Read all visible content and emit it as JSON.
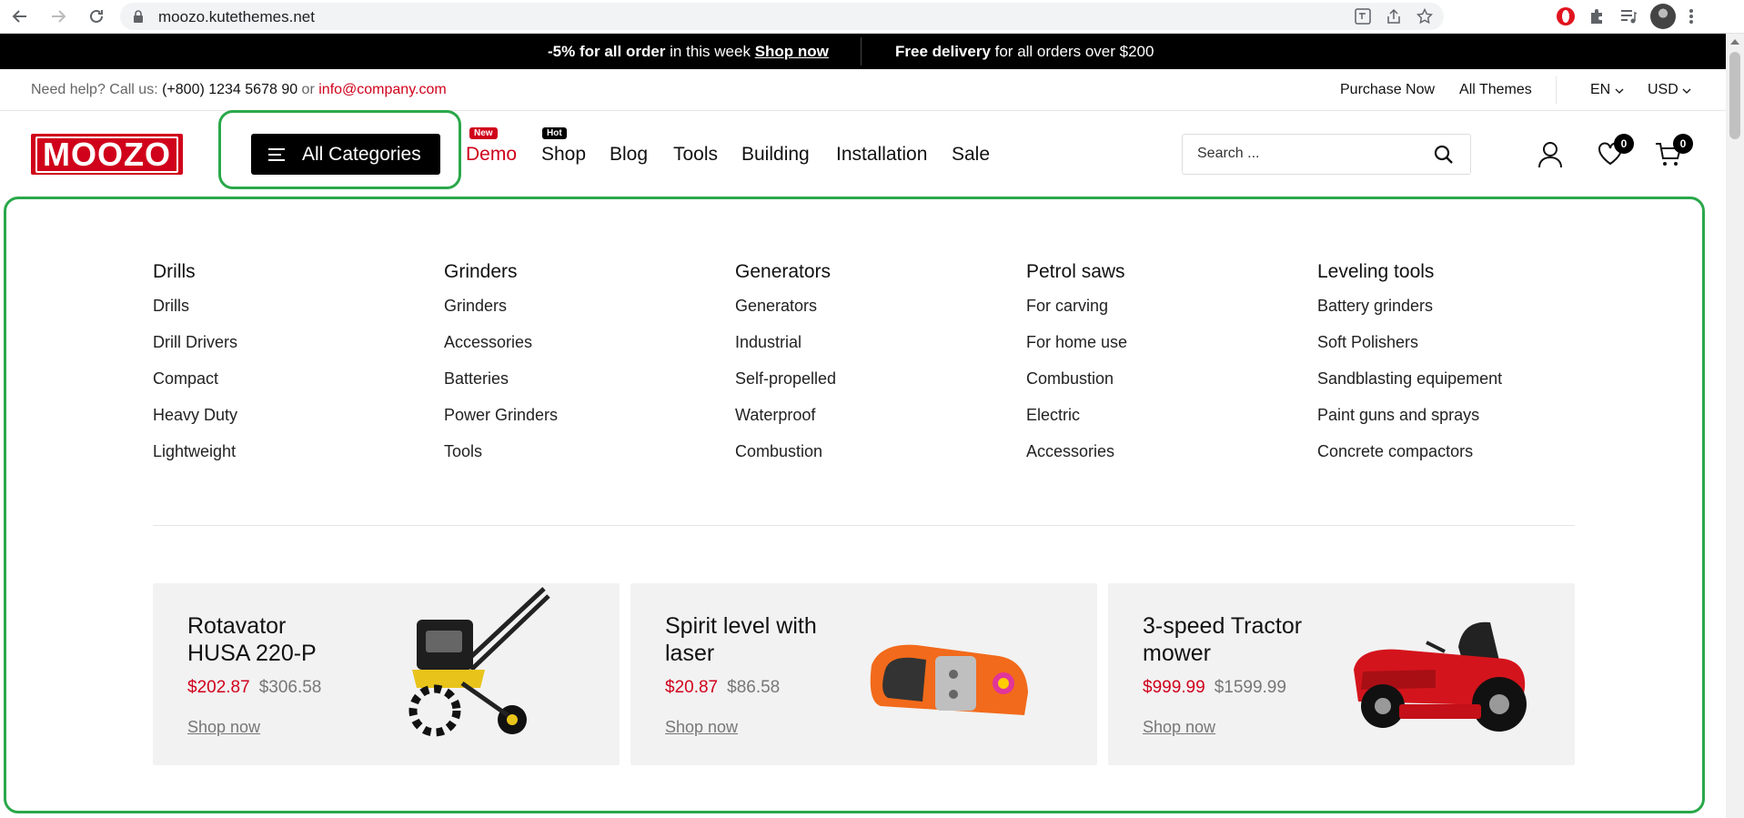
{
  "browser": {
    "url": "moozo.kutethemes.net"
  },
  "promo": {
    "offer_bold": "-5% for all order",
    "offer_text": " in this week ",
    "offer_link": "Shop now",
    "delivery_bold": "Free delivery",
    "delivery_text": " for all orders over $200"
  },
  "topbar": {
    "help_text": "Need help? Call us: ",
    "phone": "(+800) 1234 5678 90",
    "or": " or ",
    "email": "info@company.com",
    "purchase": "Purchase Now",
    "themes": "All Themes",
    "language": "EN",
    "currency": "USD"
  },
  "header": {
    "logo": "MOOZO",
    "categories_label": "All Categories",
    "nav": [
      {
        "label": "Demo",
        "badge": "New"
      },
      {
        "label": "Shop",
        "badge": "Hot"
      },
      {
        "label": "Blog"
      },
      {
        "label": "Tools"
      },
      {
        "label": "Building"
      },
      {
        "label": "Installation"
      },
      {
        "label": "Sale"
      }
    ],
    "search_placeholder": "Search ...",
    "wishlist_count": "0",
    "cart_count": "0"
  },
  "mega_menu": {
    "columns": [
      {
        "title": "Drills",
        "items": [
          "Drills",
          "Drill Drivers",
          "Compact",
          "Heavy Duty",
          "Lightweight"
        ]
      },
      {
        "title": "Grinders",
        "items": [
          "Grinders",
          "Accessories",
          "Batteries",
          "Power Grinders",
          "Tools"
        ]
      },
      {
        "title": "Generators",
        "items": [
          "Generators",
          "Industrial",
          "Self-propelled",
          "Waterproof",
          "Combustion"
        ]
      },
      {
        "title": "Petrol saws",
        "items": [
          "For carving",
          "For home use",
          "Combustion",
          "Electric",
          "Accessories"
        ]
      },
      {
        "title": "Leveling tools",
        "items": [
          "Battery grinders",
          "Soft Polishers",
          "Sandblasting equipement",
          "Paint guns and sprays",
          "Concrete compactors"
        ]
      }
    ],
    "products": [
      {
        "title": "Rotavator HUSA 220-P",
        "price": "$202.87",
        "old_price": "$306.58",
        "cta": "Shop now"
      },
      {
        "title": "Spirit level with laser",
        "price": "$20.87",
        "old_price": "$86.58",
        "cta": "Shop now"
      },
      {
        "title": "3-speed Tractor mower",
        "price": "$999.99",
        "old_price": "$1599.99",
        "cta": "Shop now"
      }
    ]
  },
  "colors": {
    "brand_red": "#d0021b",
    "highlight_green": "#2aa84a"
  }
}
